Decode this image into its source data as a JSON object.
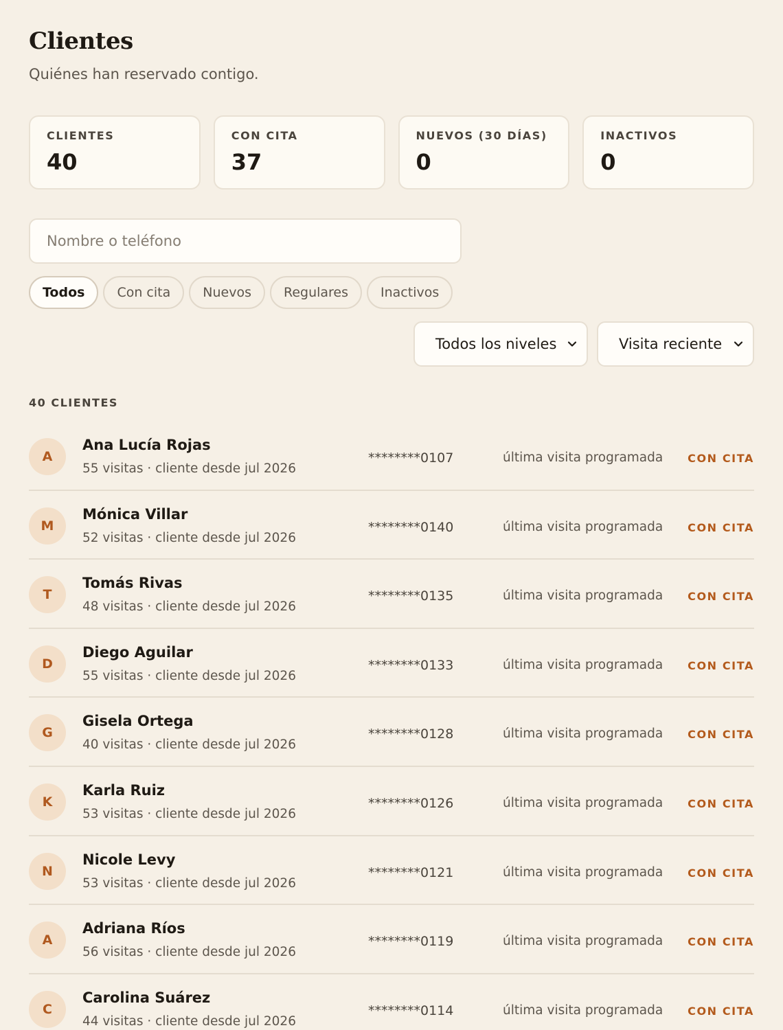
{
  "header": {
    "title": "Clientes",
    "subtitle": "Quiénes han reservado contigo."
  },
  "stats": [
    {
      "label": "CLIENTES",
      "value": "40"
    },
    {
      "label": "CON CITA",
      "value": "37"
    },
    {
      "label": "NUEVOS (30 DÍAS)",
      "value": "0"
    },
    {
      "label": "INACTIVOS",
      "value": "0"
    }
  ],
  "search": {
    "placeholder": "Nombre o teléfono",
    "value": ""
  },
  "filters": [
    {
      "label": "Todos",
      "active": true
    },
    {
      "label": "Con cita",
      "active": false
    },
    {
      "label": "Nuevos",
      "active": false
    },
    {
      "label": "Regulares",
      "active": false
    },
    {
      "label": "Inactivos",
      "active": false
    }
  ],
  "selects": {
    "levels": "Todos los niveles",
    "sort": "Visita reciente"
  },
  "list": {
    "count_label": "40 CLIENTES",
    "clients": [
      {
        "initial": "A",
        "name": "Ana Lucía Rojas",
        "meta": "55 visitas · cliente desde jul 2026",
        "phone": "********0107",
        "last": "última visita programada",
        "status": "CON CITA"
      },
      {
        "initial": "M",
        "name": "Mónica Villar",
        "meta": "52 visitas · cliente desde jul 2026",
        "phone": "********0140",
        "last": "última visita programada",
        "status": "CON CITA"
      },
      {
        "initial": "T",
        "name": "Tomás Rivas",
        "meta": "48 visitas · cliente desde jul 2026",
        "phone": "********0135",
        "last": "última visita programada",
        "status": "CON CITA"
      },
      {
        "initial": "D",
        "name": "Diego Aguilar",
        "meta": "55 visitas · cliente desde jul 2026",
        "phone": "********0133",
        "last": "última visita programada",
        "status": "CON CITA"
      },
      {
        "initial": "G",
        "name": "Gisela Ortega",
        "meta": "40 visitas · cliente desde jul 2026",
        "phone": "********0128",
        "last": "última visita programada",
        "status": "CON CITA"
      },
      {
        "initial": "K",
        "name": "Karla Ruiz",
        "meta": "53 visitas · cliente desde jul 2026",
        "phone": "********0126",
        "last": "última visita programada",
        "status": "CON CITA"
      },
      {
        "initial": "N",
        "name": "Nicole Levy",
        "meta": "53 visitas · cliente desde jul 2026",
        "phone": "********0121",
        "last": "última visita programada",
        "status": "CON CITA"
      },
      {
        "initial": "A",
        "name": "Adriana Ríos",
        "meta": "56 visitas · cliente desde jul 2026",
        "phone": "********0119",
        "last": "última visita programada",
        "status": "CON CITA"
      },
      {
        "initial": "C",
        "name": "Carolina Suárez",
        "meta": "44 visitas · cliente desde jul 2026",
        "phone": "********0114",
        "last": "última visita programada",
        "status": "CON CITA"
      }
    ]
  }
}
